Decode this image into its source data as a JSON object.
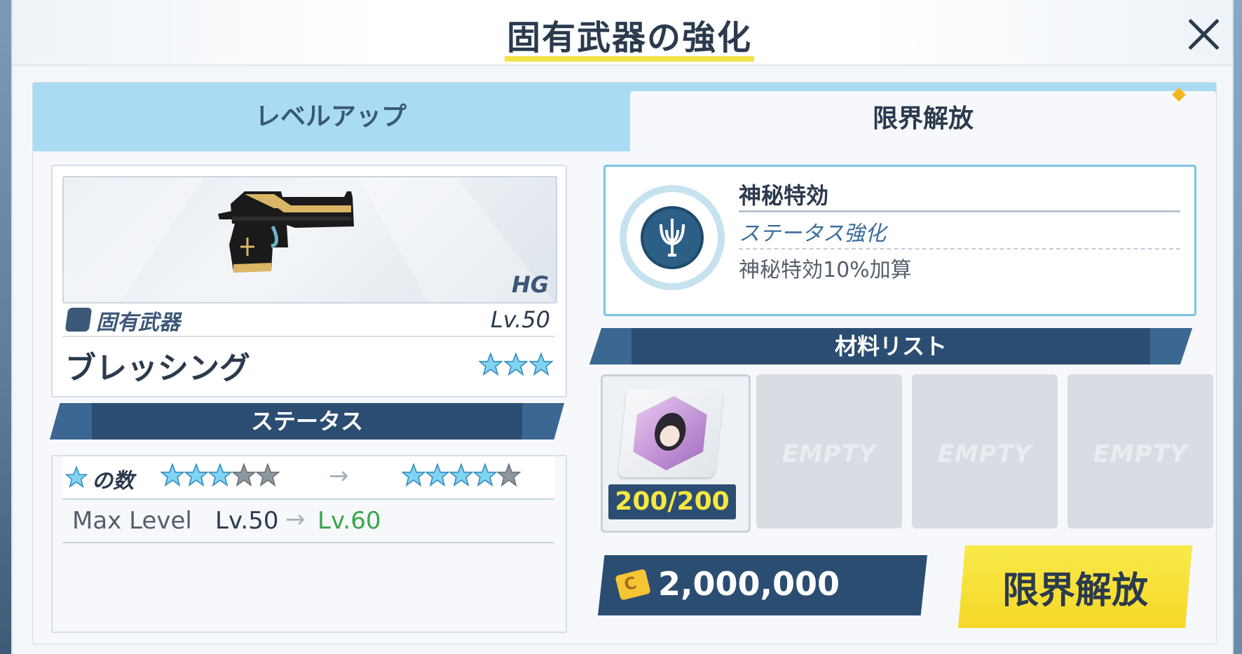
{
  "header": {
    "title": "固有武器の強化"
  },
  "tabs": [
    {
      "label": "レベルアップ",
      "active": false
    },
    {
      "label": "限界解放",
      "active": true
    }
  ],
  "weapon": {
    "category": "HG",
    "type_label": "固有武器",
    "level": "Lv.50",
    "name": "ブレッシング",
    "stars": 3
  },
  "status": {
    "header": "ステータス",
    "star_row_label": "の数",
    "stars_before_filled": 3,
    "stars_after_filled": 4,
    "stars_total": 5,
    "max_level_label": "Max Level",
    "max_level_from": "Lv.50",
    "max_level_to": "Lv.60"
  },
  "effect": {
    "title": "神秘特効",
    "subtitle": "ステータス強化",
    "description": "神秘特効10%加算"
  },
  "materials": {
    "header": "材料リスト",
    "slots": [
      {
        "count": "200/200",
        "empty": false
      },
      {
        "label": "EMPTY",
        "empty": true
      },
      {
        "label": "EMPTY",
        "empty": true
      },
      {
        "label": "EMPTY",
        "empty": true
      }
    ]
  },
  "cost": {
    "credits": "2,000,000"
  },
  "action": {
    "label": "限界解放"
  },
  "colors": {
    "tab_bg": "#a9dcf2",
    "header_navy": "#2c4d72",
    "button_yellow": "#f6df36",
    "accent_green": "#3aa54b",
    "title_underline": "#f4e24b"
  }
}
